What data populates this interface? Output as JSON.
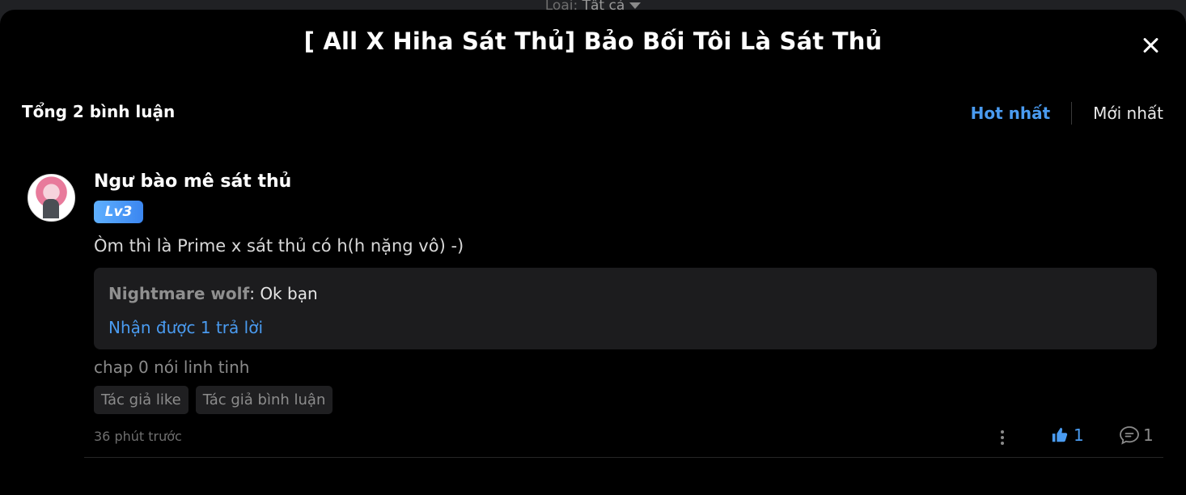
{
  "background": {
    "filter_label": "Loại:",
    "filter_value": "Tất cả"
  },
  "modal": {
    "title": "[ All X Hiha Sát Thủ] Bảo Bối Tôi Là Sát Thủ"
  },
  "comments_header": {
    "total": "Tổng 2 bình luận",
    "sort_hot": "Hot nhất",
    "sort_new": "Mới nhất"
  },
  "comment": {
    "username": "Ngư bào mê sát thủ",
    "level": "Lv3",
    "text": "Òm thì là Prime x sát thủ có h(h nặng vô) -)",
    "reply": {
      "author": "Nightmare wolf",
      "text": ": Ok bạn",
      "count_label": "Nhận được 1 trả lời"
    },
    "chap_note": "chap 0 nói linh tinh",
    "tags": [
      "Tác giả like",
      "Tác giả bình luận"
    ],
    "time": "36 phút trước",
    "likes": "1",
    "replies": "1"
  },
  "colors": {
    "accent": "#4a9bf0",
    "modal_bg": "#000000",
    "reply_bg": "#1c1c1e"
  }
}
